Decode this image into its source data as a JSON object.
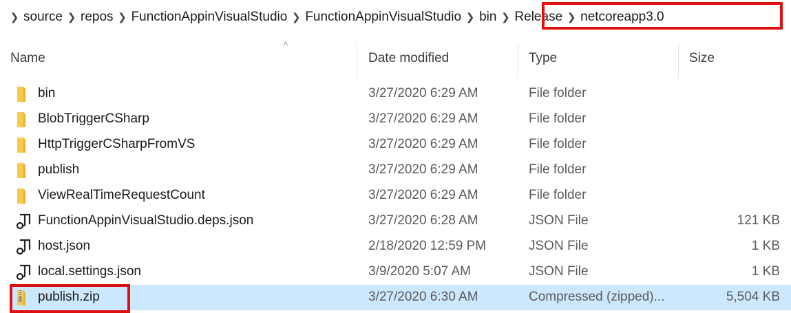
{
  "breadcrumb": {
    "items": [
      "source",
      "repos",
      "FunctionAppinVisualStudio",
      "FunctionAppinVisualStudio",
      "bin",
      "Release",
      "netcoreapp3.0"
    ]
  },
  "columns": {
    "name": "Name",
    "date": "Date modified",
    "type": "Type",
    "size": "Size"
  },
  "files": [
    {
      "name": "bin",
      "date": "3/27/2020 6:29 AM",
      "type": "File folder",
      "size": "",
      "icon": "folder-icon"
    },
    {
      "name": "BlobTriggerCSharp",
      "date": "3/27/2020 6:29 AM",
      "type": "File folder",
      "size": "",
      "icon": "folder-icon"
    },
    {
      "name": "HttpTriggerCSharpFromVS",
      "date": "3/27/2020 6:29 AM",
      "type": "File folder",
      "size": "",
      "icon": "folder-icon"
    },
    {
      "name": "publish",
      "date": "3/27/2020 6:29 AM",
      "type": "File folder",
      "size": "",
      "icon": "folder-icon"
    },
    {
      "name": "ViewRealTimeRequestCount",
      "date": "3/27/2020 6:29 AM",
      "type": "File folder",
      "size": "",
      "icon": "folder-icon"
    },
    {
      "name": "FunctionAppinVisualStudio.deps.json",
      "date": "3/27/2020 6:28 AM",
      "type": "JSON File",
      "size": "121 KB",
      "icon": "json-file-icon"
    },
    {
      "name": "host.json",
      "date": "2/18/2020 12:59 PM",
      "type": "JSON File",
      "size": "1 KB",
      "icon": "json-file-icon"
    },
    {
      "name": "local.settings.json",
      "date": "3/9/2020 5:07 AM",
      "type": "JSON File",
      "size": "1 KB",
      "icon": "json-file-icon"
    },
    {
      "name": "publish.zip",
      "date": "3/27/2020 6:30 AM",
      "type": "Compressed (zipped)...",
      "size": "5,504 KB",
      "icon": "zip-folder-icon"
    }
  ],
  "selected_index": 8,
  "colors": {
    "highlight_box": "#e01010",
    "selection": "#cce8ff",
    "folder": "#f8c94a"
  }
}
